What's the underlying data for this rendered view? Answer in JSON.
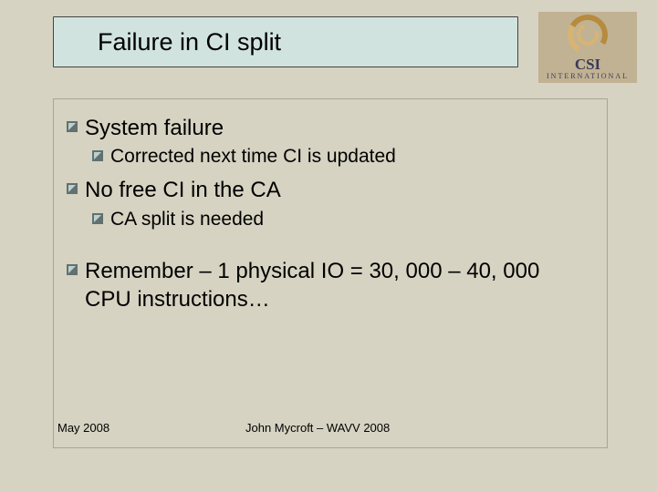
{
  "title": "Failure in CI split",
  "logo": {
    "name": "CSI",
    "subname": "INTERNATIONAL"
  },
  "bullets": [
    {
      "level": 1,
      "text": "System failure"
    },
    {
      "level": 2,
      "text": "Corrected next time CI is updated"
    },
    {
      "level": 1,
      "text": "No free CI in the CA"
    },
    {
      "level": 2,
      "text": "CA split is needed"
    },
    {
      "level": 1,
      "text": "Remember – 1 physical IO = 30, 000 – 40, 000 CPU instructions…",
      "gap_before": true
    }
  ],
  "footer": {
    "left": "May 2008",
    "center": "John Mycroft – WAVV 2008"
  }
}
